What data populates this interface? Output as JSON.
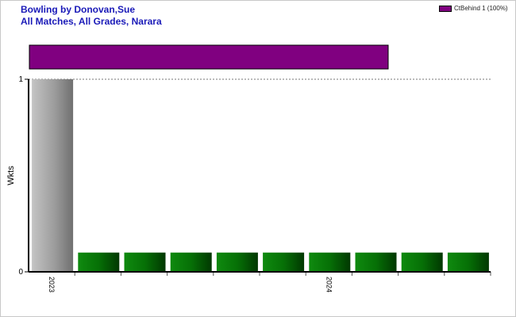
{
  "header": {
    "title": "Bowling by Donovan,Sue",
    "subtitle": "All Matches, All Grades, Narara"
  },
  "legend": {
    "label": "CtBehind 1 (100%)",
    "color": "#800080"
  },
  "chart_data": {
    "type": "bar",
    "ylabel": "Wkts",
    "ylim": [
      0,
      1
    ],
    "yticks": [
      0,
      1
    ],
    "grid": "dashed line at top",
    "legend_position": "top-right",
    "x_tick_labels": [
      {
        "label": "2023",
        "bar_index": 0
      },
      {
        "label": "2024",
        "bar_index": 6
      }
    ],
    "categories": [
      "",
      "",
      "",
      "",
      "",
      "",
      "",
      "",
      "",
      ""
    ],
    "series": [
      {
        "values": [
          1,
          0,
          0,
          0,
          0,
          0,
          0,
          0,
          0,
          0
        ]
      }
    ],
    "bar_colors": [
      "gray",
      "green",
      "green",
      "green",
      "green",
      "green",
      "green",
      "green",
      "green",
      "green"
    ],
    "dismissal_bar": {
      "label": "CtBehind 1 (100%)",
      "value": 1,
      "color": "#800080"
    }
  }
}
